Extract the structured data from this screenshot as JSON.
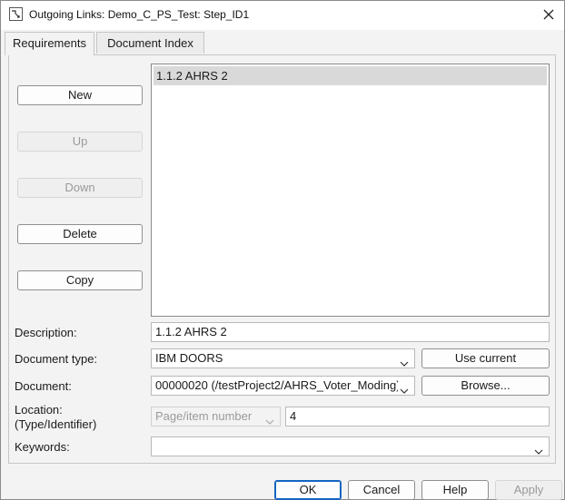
{
  "window": {
    "title": "Outgoing Links: Demo_C_PS_Test: Step_ID1"
  },
  "tabs": [
    {
      "label": "Requirements",
      "active": true
    },
    {
      "label": "Document Index",
      "active": false
    }
  ],
  "side_buttons": {
    "new": "New",
    "up": "Up",
    "down": "Down",
    "delete": "Delete",
    "copy": "Copy"
  },
  "links_list": {
    "items": [
      "1.1.2 AHRS 2"
    ],
    "selected_index": 0
  },
  "form": {
    "description_label": "Description:",
    "description_value": "1.1.2 AHRS 2",
    "doctype_label": "Document type:",
    "doctype_value": "IBM DOORS",
    "use_current_label": "Use current",
    "document_label": "Document:",
    "document_value": "00000020 (/testProject2/AHRS_Voter_Moding)",
    "browse_label": "Browse...",
    "location_label_1": "Location:",
    "location_label_2": "(Type/Identifier)",
    "location_type_value": "Page/item number",
    "location_id_value": "4",
    "keywords_label": "Keywords:",
    "keywords_value": ""
  },
  "footer": {
    "ok": "OK",
    "cancel": "Cancel",
    "help": "Help",
    "apply": "Apply"
  },
  "colors": {
    "default_button_border": "#1565c0",
    "selection_background": "#d9d9d9",
    "disabled_text": "#9a9a9a"
  }
}
